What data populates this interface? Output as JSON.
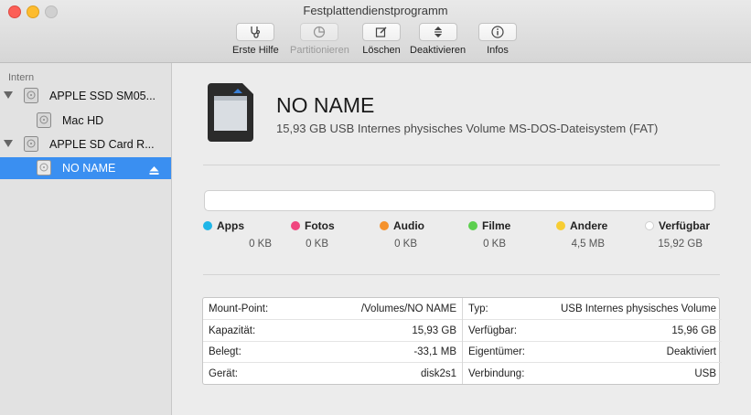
{
  "window": {
    "title": "Festplattendienstprogramm"
  },
  "toolbar": [
    {
      "label": "Erste Hilfe",
      "icon": "stethoscope-icon",
      "enabled": true
    },
    {
      "label": "Partitionieren",
      "icon": "pie-icon",
      "enabled": false
    },
    {
      "label": "Löschen",
      "icon": "erase-icon",
      "enabled": true
    },
    {
      "label": "Deaktivieren",
      "icon": "unmount-icon",
      "enabled": true
    },
    {
      "label": "Infos",
      "icon": "info-icon",
      "enabled": true
    }
  ],
  "sidebar": {
    "section": "Intern",
    "items": [
      {
        "label": "APPLE SSD SM05...",
        "level": 0,
        "expanded": true
      },
      {
        "label": "Mac HD",
        "level": 1
      },
      {
        "label": "APPLE SD Card R...",
        "level": 0,
        "expanded": true
      },
      {
        "label": "NO NAME",
        "level": 1,
        "selected": true,
        "ejectable": true
      }
    ]
  },
  "volume": {
    "name": "NO NAME",
    "description": "15,93 GB USB Internes physisches Volume MS-DOS-Dateisystem (FAT)"
  },
  "legend": [
    {
      "name": "Apps",
      "value": "0 KB",
      "color": "#1fb6e8"
    },
    {
      "name": "Fotos",
      "value": "0 KB",
      "color": "#f0457e"
    },
    {
      "name": "Audio",
      "value": "0 KB",
      "color": "#f5922c"
    },
    {
      "name": "Filme",
      "value": "0 KB",
      "color": "#5ccf4e"
    },
    {
      "name": "Andere",
      "value": "4,5 MB",
      "color": "#f7cd33"
    },
    {
      "name": "Verfügbar",
      "value": "15,92 GB",
      "color": "#ffffff"
    }
  ],
  "info": {
    "left": [
      {
        "key": "Mount-Point:",
        "value": "/Volumes/NO NAME"
      },
      {
        "key": "Kapazität:",
        "value": "15,93 GB"
      },
      {
        "key": "Belegt:",
        "value": "-33,1 MB"
      },
      {
        "key": "Gerät:",
        "value": "disk2s1"
      }
    ],
    "right": [
      {
        "key": "Typ:",
        "value": "USB Internes physisches Volume"
      },
      {
        "key": "Verfügbar:",
        "value": "15,96 GB"
      },
      {
        "key": "Eigentümer:",
        "value": "Deaktiviert"
      },
      {
        "key": "Verbindung:",
        "value": "USB"
      }
    ]
  }
}
